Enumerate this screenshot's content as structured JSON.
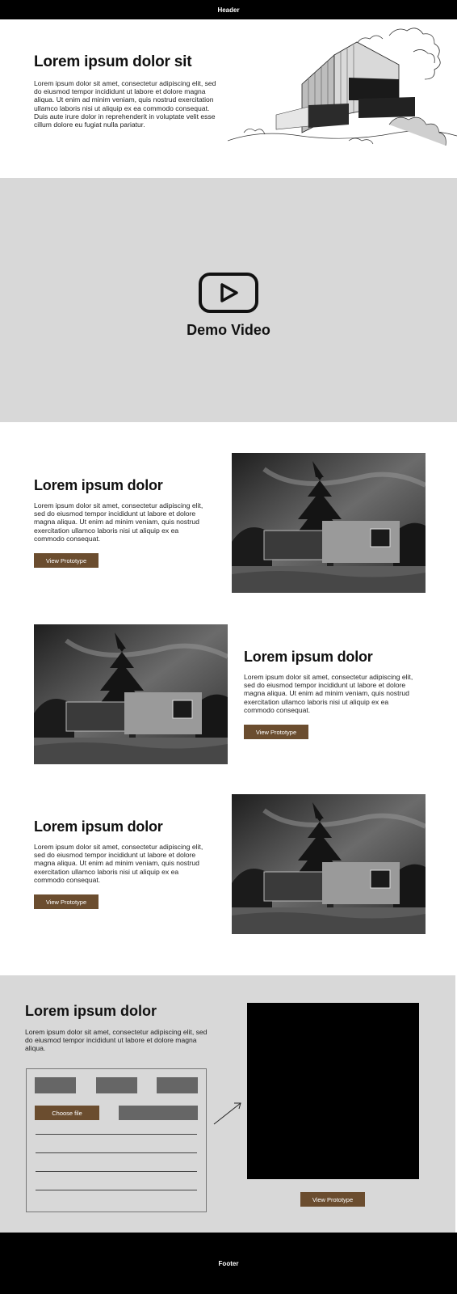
{
  "header": {
    "label": "Header"
  },
  "hero": {
    "title": "Lorem ipsum dolor sit",
    "body": "Lorem ipsum dolor sit amet, consectetur adipiscing elit, sed do eiusmod tempor incididunt ut labore et dolore magna aliqua. Ut enim ad minim veniam, quis nostrud exercitation ullamco laboris nisi ut aliquip ex ea commodo consequat. Duis aute irure dolor in reprehenderit in voluptate velit esse cillum dolore eu fugiat nulla pariatur."
  },
  "video": {
    "label": "Demo Video"
  },
  "features": [
    {
      "title": "Lorem ipsum dolor",
      "body": "Lorem ipsum dolor sit amet, consectetur adipiscing elit, sed do eiusmod tempor incididunt ut labore et dolore magna aliqua. Ut enim ad minim veniam, quis nostrud exercitation ullamco laboris nisi ut aliquip ex ea commodo consequat.",
      "button": "View Prototype"
    },
    {
      "title": "Lorem ipsum dolor",
      "body": "Lorem ipsum dolor sit amet, consectetur adipiscing elit, sed do eiusmod tempor incididunt ut labore et dolore magna aliqua. Ut enim ad minim veniam, quis nostrud exercitation ullamco laboris nisi ut aliquip ex ea commodo consequat.",
      "button": "View Prototype"
    },
    {
      "title": "Lorem ipsum dolor",
      "body": "Lorem ipsum dolor sit amet, consectetur adipiscing elit, sed do eiusmod tempor incididunt ut labore et dolore magna aliqua. Ut enim ad minim veniam, quis nostrud exercitation ullamco laboris nisi ut aliquip ex ea commodo consequat.",
      "button": "View Prototype"
    }
  ],
  "upload": {
    "title": "Lorem ipsum dolor",
    "body": "Lorem ipsum dolor sit amet, consectetur adipiscing elit, sed do eiusmod tempor incididunt ut labore et dolore magna aliqua.",
    "choose_file": "Choose file",
    "button": "View Prototype"
  },
  "footer": {
    "label": "Footer"
  },
  "colors": {
    "accent": "#6b4d2f",
    "band": "#d8d8d8",
    "bar": "#000000"
  },
  "icons": {
    "video": "play-icon",
    "arrow": "arrow-icon"
  }
}
